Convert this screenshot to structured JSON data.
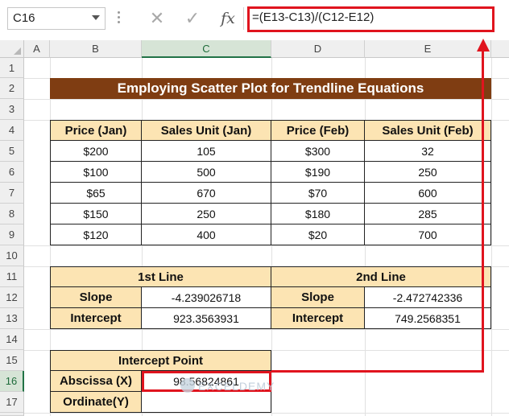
{
  "name_box": {
    "value": "C16"
  },
  "formula_bar": {
    "cancel_icon": "✕",
    "enter_icon": "✓",
    "fx_label": "fx",
    "formula": "=(E13-C13)/(C12-E12)"
  },
  "columns": [
    "A",
    "B",
    "C",
    "D",
    "E"
  ],
  "rows": [
    "1",
    "2",
    "3",
    "4",
    "5",
    "6",
    "7",
    "8",
    "9",
    "10",
    "11",
    "12",
    "13",
    "14",
    "15",
    "16",
    "17"
  ],
  "title": "Employing Scatter Plot for Trendline Equations",
  "price_table": {
    "headers": [
      "Price (Jan)",
      "Sales Unit (Jan)",
      "Price (Feb)",
      "Sales Unit (Feb)"
    ],
    "rows": [
      [
        "$200",
        "105",
        "$300",
        "32"
      ],
      [
        "$100",
        "500",
        "$190",
        "250"
      ],
      [
        "$65",
        "670",
        "$70",
        "600"
      ],
      [
        "$150",
        "250",
        "$180",
        "285"
      ],
      [
        "$120",
        "400",
        "$20",
        "700"
      ]
    ]
  },
  "lines_table": {
    "line1_header": "1st Line",
    "line2_header": "2nd Line",
    "slope_label": "Slope",
    "intercept_label": "Intercept",
    "line1_slope": "-4.239026718",
    "line1_intercept": "923.3563931",
    "line2_slope": "-2.472742336",
    "line2_intercept": "749.2568351"
  },
  "intercept_table": {
    "header": "Intercept Point",
    "abscissa_label": "Abscissa (X)",
    "abscissa_value": "98.56824861",
    "ordinate_label": "Ordinate(Y)",
    "ordinate_value": ""
  },
  "watermark": "EXCELDEMY",
  "colors": {
    "title_bg": "#7f3d12",
    "header_bg": "#fce4b3",
    "highlight": "#e0141e"
  }
}
